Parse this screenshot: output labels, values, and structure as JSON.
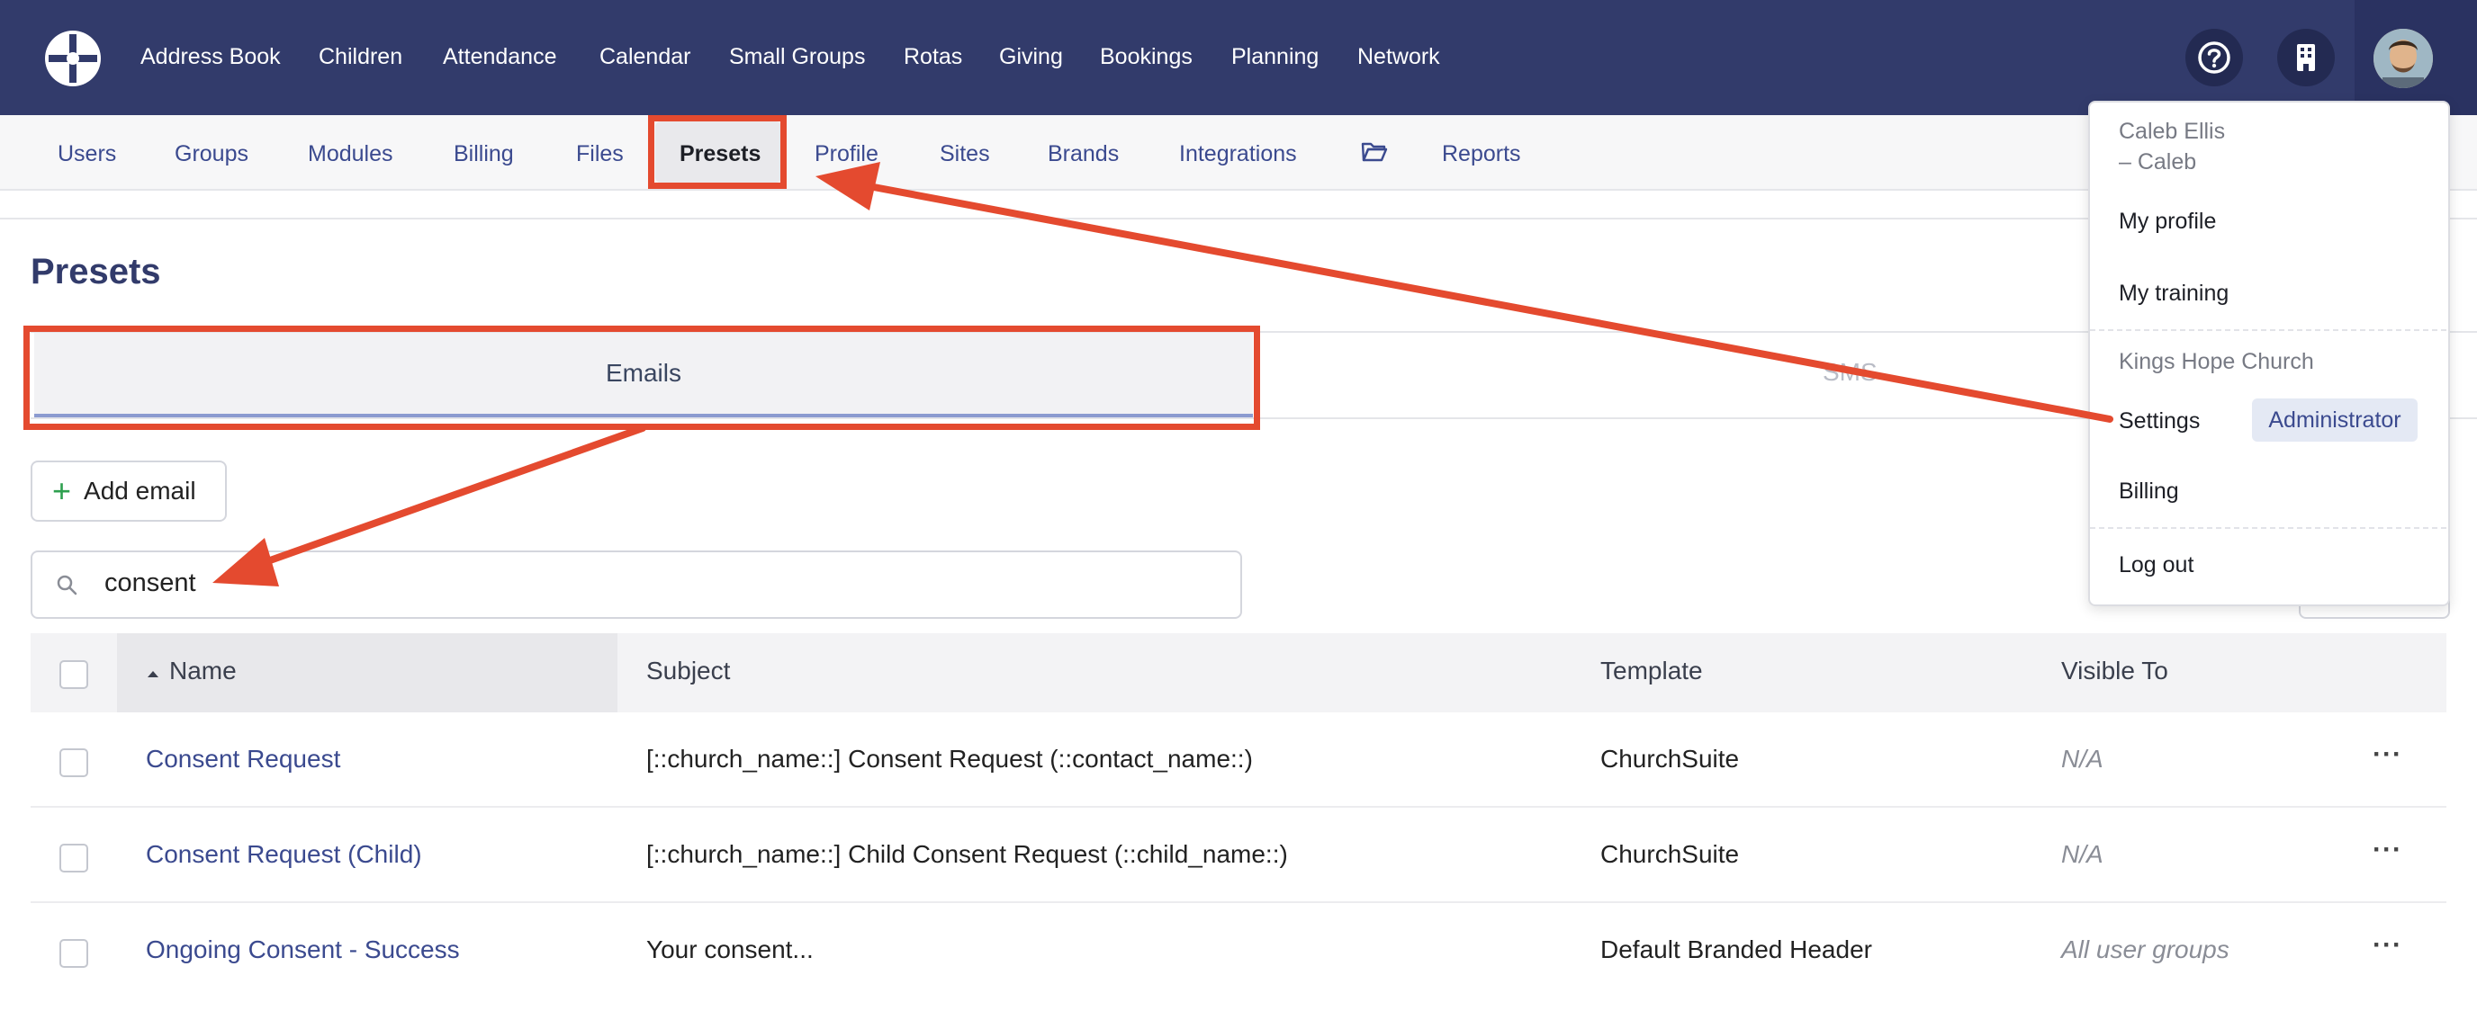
{
  "topnav": {
    "items": [
      "Address Book",
      "Children",
      "Attendance",
      "Calendar",
      "Small Groups",
      "Rotas",
      "Giving",
      "Bookings",
      "Planning",
      "Network"
    ],
    "help_icon": "question-circle-icon",
    "org_icon": "building-icon",
    "avatar_icon": "user-avatar"
  },
  "subnav": {
    "items": [
      "Users",
      "Groups",
      "Modules",
      "Billing",
      "Files",
      "Presets",
      "Profile",
      "Sites",
      "Brands",
      "Integrations",
      "Reports"
    ],
    "active": "Presets",
    "reports_icon": "folder-open-icon"
  },
  "page": {
    "title": "Presets",
    "tabs": [
      "Emails",
      "SMS"
    ],
    "active_tab": "Emails",
    "add_button": "Add email",
    "search": {
      "value": "consent",
      "icon": "search-icon"
    }
  },
  "table": {
    "headers": [
      "Name",
      "Subject",
      "Template",
      "Visible To"
    ],
    "sort_icon": "sort-asc-icon",
    "rows": [
      {
        "name": "Consent Request",
        "subject": "[::church_name::] Consent Request (::contact_name::)",
        "template": "ChurchSuite",
        "visible_to": "N/A"
      },
      {
        "name": "Consent Request (Child)",
        "subject": "[::church_name::] Child Consent Request (::child_name::)",
        "template": "ChurchSuite",
        "visible_to": "N/A"
      },
      {
        "name": "Ongoing Consent - Success",
        "subject": "Your consent...",
        "template": "Default Branded Header",
        "visible_to": "All user groups"
      }
    ],
    "row_action": "···"
  },
  "dropdown": {
    "user_name": "Caleb Ellis",
    "user_sub": "– Caleb",
    "my_profile": "My profile",
    "my_training": "My training",
    "org_name": "Kings Hope Church",
    "settings": "Settings",
    "role_badge": "Administrator",
    "billing": "Billing",
    "logout": "Log out"
  },
  "colors": {
    "nav_bg": "#323b6b",
    "link": "#3b4a8f",
    "annotation": "#e44a2f",
    "add_icon": "#2ea04f"
  }
}
